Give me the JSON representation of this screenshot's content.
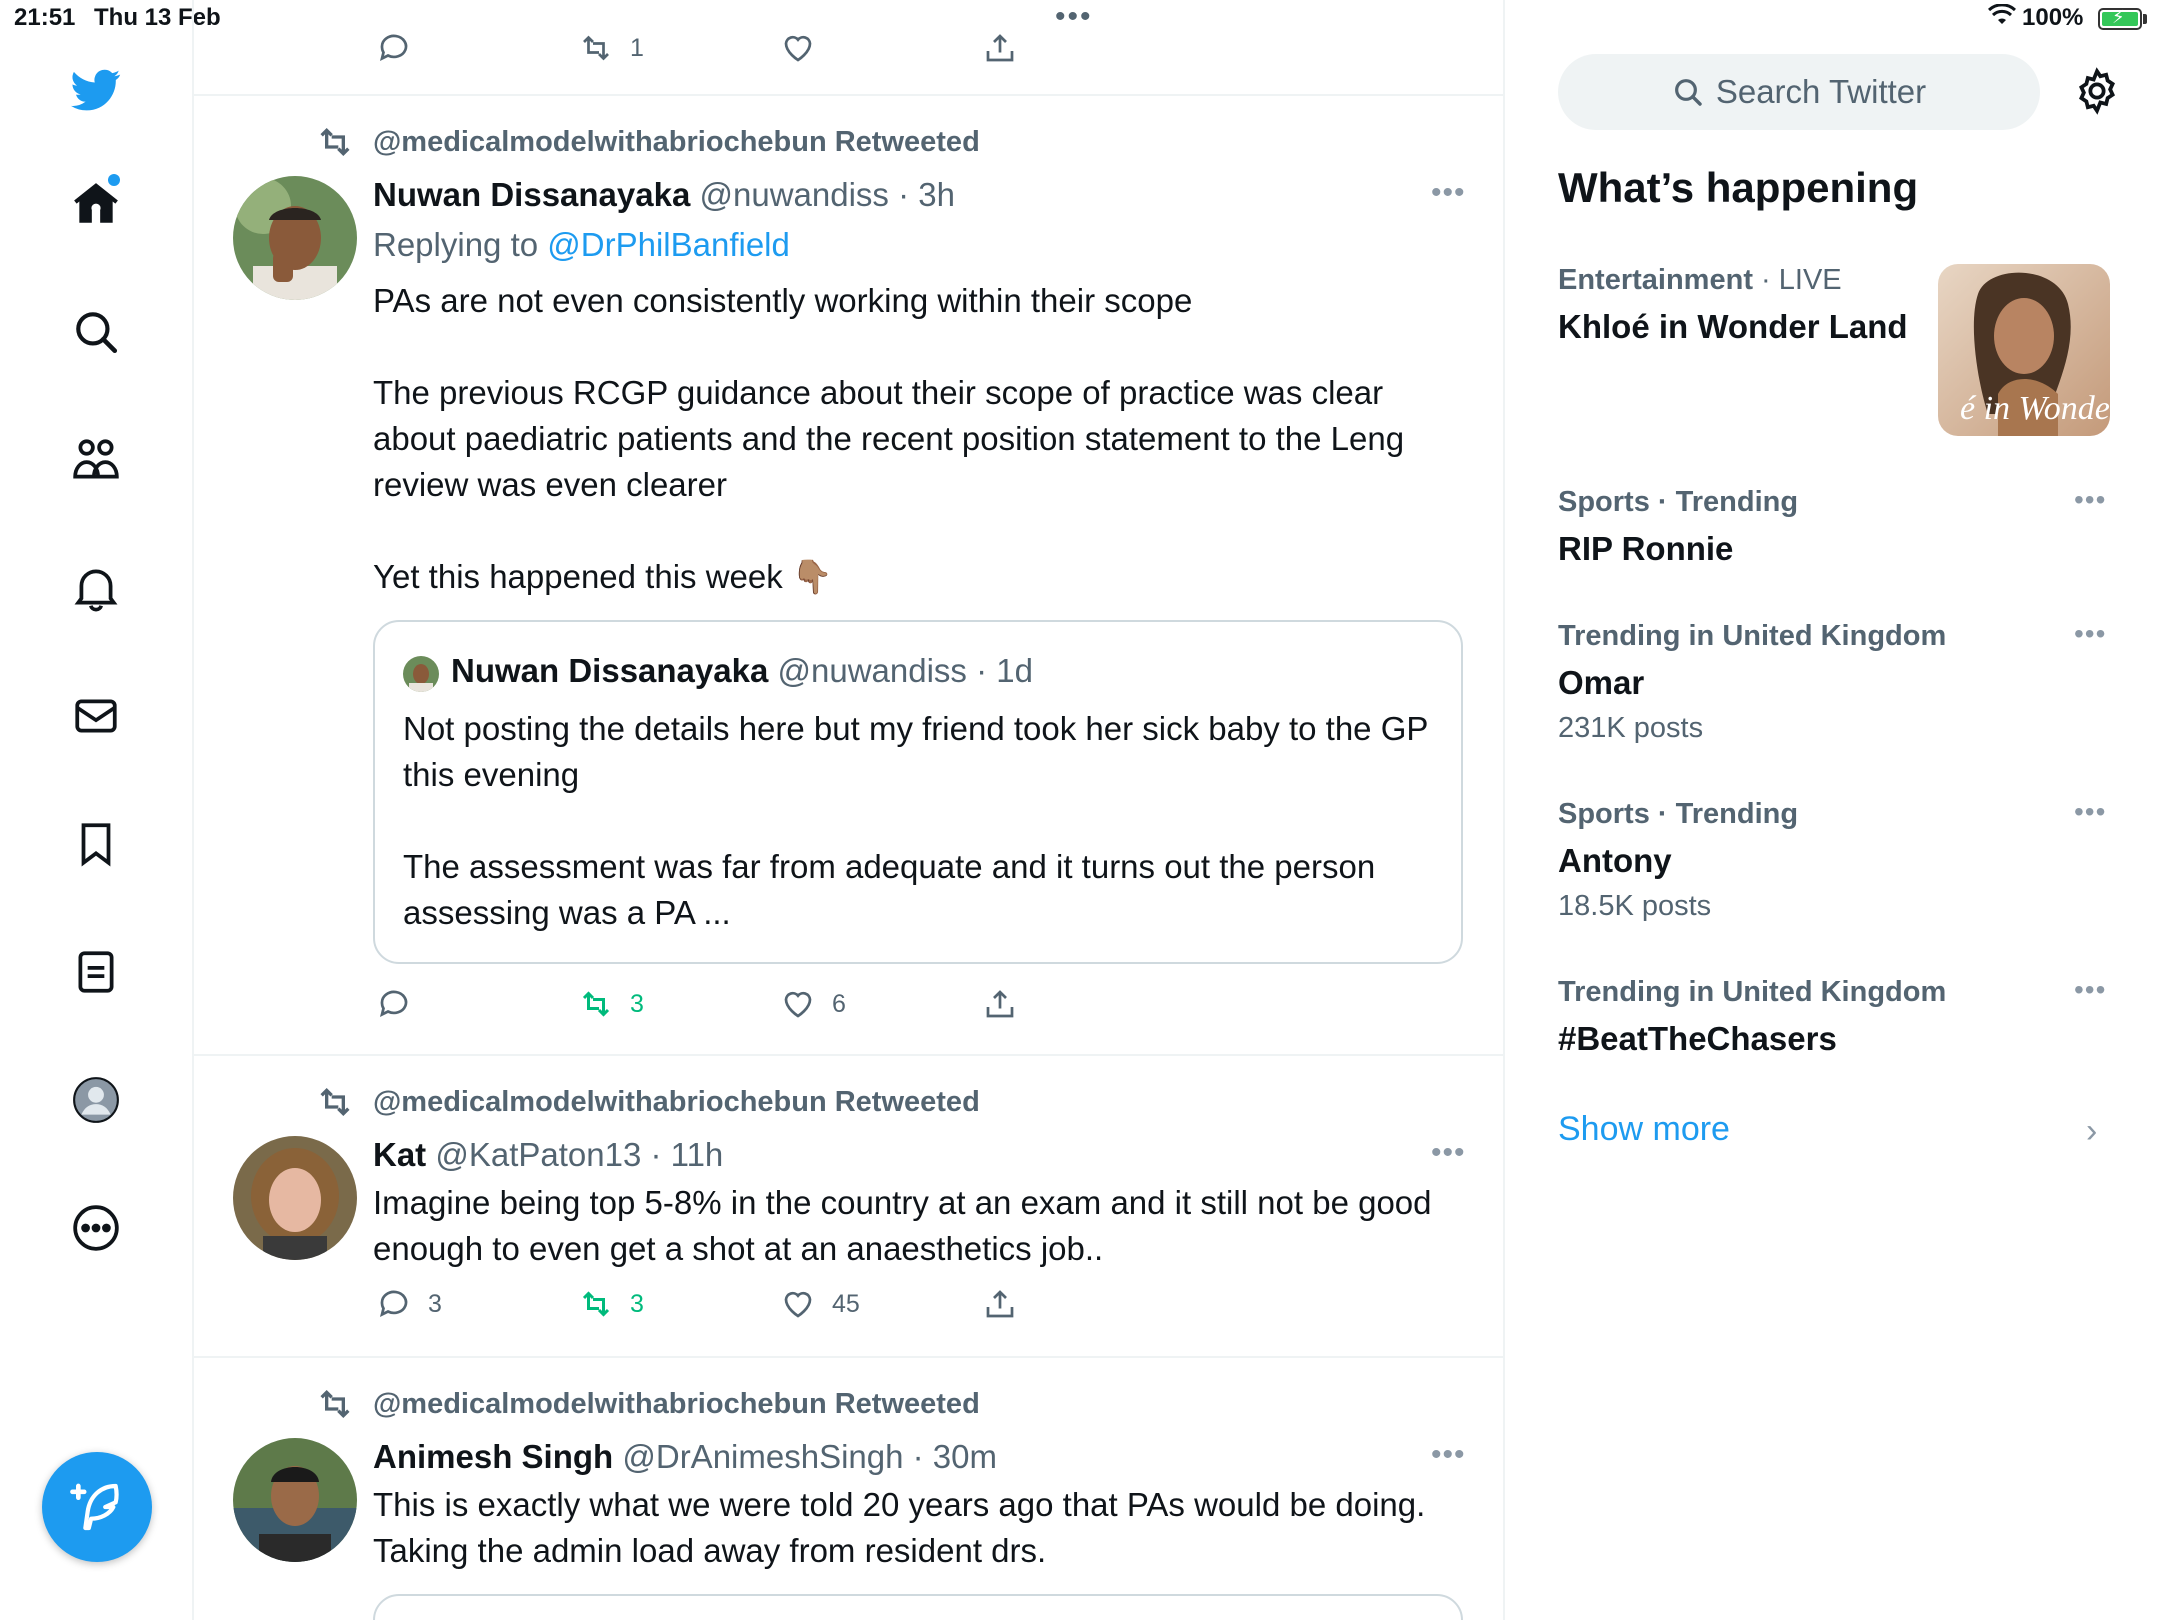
{
  "status_bar": {
    "time": "21:51",
    "date": "Thu 13 Feb",
    "battery": "100%"
  },
  "nav": {
    "items": [
      "home-icon",
      "search-icon",
      "communities-icon",
      "notifications-icon",
      "messages-icon",
      "bookmarks-icon",
      "lists-icon",
      "profile-icon",
      "more-icon"
    ],
    "brand_color": "#1d9bf0"
  },
  "timeline": {
    "top_tweet_actions": {
      "retweets": "1"
    },
    "tweets": [
      {
        "retweeted_by": "@medicalmodelwithabriochebun Retweeted",
        "name": "Nuwan Dissanayaka",
        "handle": "@nuwandiss · 3h",
        "replying_prefix": "Replying to ",
        "replying_to": "@DrPhilBanfield",
        "text": "PAs are not even consistently working within their scope\n\nThe previous RCGP guidance about their scope of practice was clear about paediatric patients and the recent position statement to the Leng review was even clearer\n\nYet this happened this week 👇🏽",
        "quote": {
          "name": "Nuwan Dissanayaka",
          "handle": "@nuwandiss · 1d",
          "text": "Not posting the details here but my friend took her sick baby to the GP this evening\n\nThe assessment was far from adequate and it turns out the person assessing was a PA ..."
        },
        "replies": "",
        "retweets": "3",
        "likes": "6"
      },
      {
        "retweeted_by": "@medicalmodelwithabriochebun Retweeted",
        "name": "Kat",
        "handle": "@KatPaton13 · 11h",
        "text": "Imagine being top 5-8% in the country at an exam and it still not be good enough to even get a shot at an anaesthetics job..",
        "replies": "3",
        "retweets": "3",
        "likes": "45"
      },
      {
        "retweeted_by": "@medicalmodelwithabriochebun Retweeted",
        "name": "Animesh Singh",
        "handle": "@DrAnimeshSingh · 30m",
        "text": "This is exactly what we were told 20 years ago that PAs would be doing. Taking the admin load away from resident drs."
      }
    ]
  },
  "sidebar": {
    "search_placeholder": "Search Twitter",
    "heading": "What’s happening",
    "trends": [
      {
        "meta": "Entertainment",
        "meta_extra": " · LIVE",
        "title": "Khloé in Wonder Land",
        "image_caption": "é in Wonder L"
      },
      {
        "meta": "Sports · Trending",
        "title": "RIP Ronnie"
      },
      {
        "meta": "Trending in United Kingdom",
        "title": "Omar",
        "count": "231K posts"
      },
      {
        "meta": "Sports · Trending",
        "title": "Antony",
        "count": "18.5K posts"
      },
      {
        "meta": "Trending in United Kingdom",
        "title": "#BeatTheChasers"
      }
    ],
    "show_more": "Show more"
  }
}
